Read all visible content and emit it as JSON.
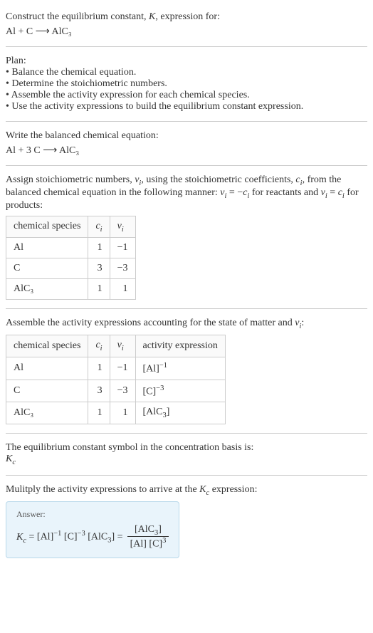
{
  "prompt": {
    "line1": "Construct the equilibrium constant, K, expression for:",
    "equation": "Al + C ⟶ AlC₃"
  },
  "plan": {
    "heading": "Plan:",
    "items": [
      "Balance the chemical equation.",
      "Determine the stoichiometric numbers.",
      "Assemble the activity expression for each chemical species.",
      "Use the activity expressions to build the equilibrium constant expression."
    ]
  },
  "balanced": {
    "heading": "Write the balanced chemical equation:",
    "equation": "Al + 3 C ⟶ AlC₃"
  },
  "stoich": {
    "heading": "Assign stoichiometric numbers, νᵢ, using the stoichiometric coefficients, cᵢ, from the balanced chemical equation in the following manner: νᵢ = −cᵢ for reactants and νᵢ = cᵢ for products:",
    "headers": {
      "species": "chemical species",
      "ci": "cᵢ",
      "vi": "νᵢ"
    },
    "rows": [
      {
        "species": "Al",
        "ci": "1",
        "vi": "−1"
      },
      {
        "species": "C",
        "ci": "3",
        "vi": "−3"
      },
      {
        "species": "AlC₃",
        "ci": "1",
        "vi": "1"
      }
    ]
  },
  "activity": {
    "heading": "Assemble the activity expressions accounting for the state of matter and νᵢ:",
    "headers": {
      "species": "chemical species",
      "ci": "cᵢ",
      "vi": "νᵢ",
      "expr": "activity expression"
    },
    "rows": [
      {
        "species": "Al",
        "ci": "1",
        "vi": "−1",
        "expr": "[Al]⁻¹"
      },
      {
        "species": "C",
        "ci": "3",
        "vi": "−3",
        "expr": "[C]⁻³"
      },
      {
        "species": "AlC₃",
        "ci": "1",
        "vi": "1",
        "expr": "[AlC₃]"
      }
    ]
  },
  "symbol": {
    "heading": "The equilibrium constant symbol in the concentration basis is:",
    "value": "K_c"
  },
  "multiply": {
    "heading": "Mulitply the activity expressions to arrive at the K_c expression:"
  },
  "answer": {
    "label": "Answer:",
    "lhs": "K_c = [Al]⁻¹ [C]⁻³ [AlC₃] =",
    "numerator": "[AlC₃]",
    "denominator": "[Al] [C]³"
  },
  "chart_data": {
    "type": "table",
    "tables": [
      {
        "title": "Stoichiometric numbers",
        "columns": [
          "chemical species",
          "c_i",
          "ν_i"
        ],
        "rows": [
          [
            "Al",
            1,
            -1
          ],
          [
            "C",
            3,
            -3
          ],
          [
            "AlC3",
            1,
            1
          ]
        ]
      },
      {
        "title": "Activity expressions",
        "columns": [
          "chemical species",
          "c_i",
          "ν_i",
          "activity expression"
        ],
        "rows": [
          [
            "Al",
            1,
            -1,
            "[Al]^-1"
          ],
          [
            "C",
            3,
            -3,
            "[C]^-3"
          ],
          [
            "AlC3",
            1,
            1,
            "[AlC3]"
          ]
        ]
      }
    ]
  }
}
